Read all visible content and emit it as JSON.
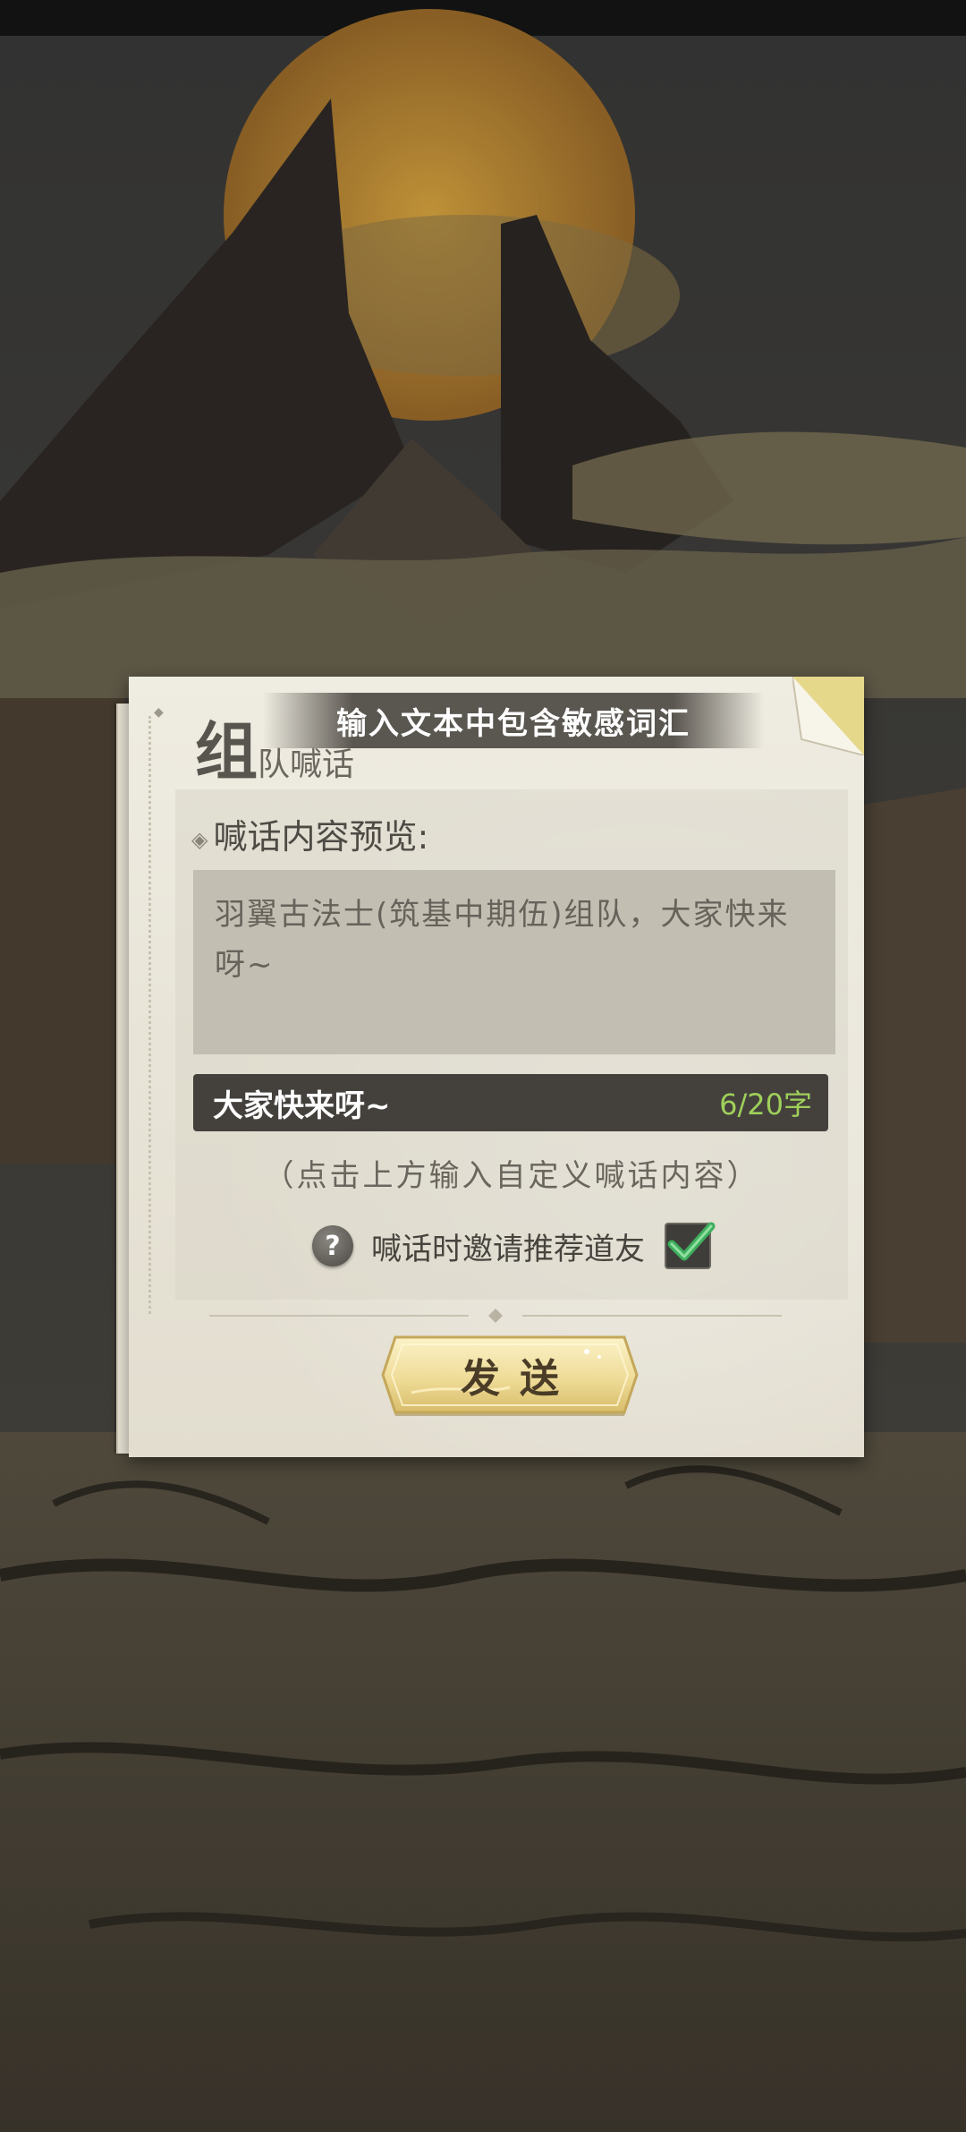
{
  "dialog": {
    "banner": "输入文本中包含敏感词汇",
    "title_big": "组",
    "title_small": "队喊话",
    "preview_label": "喊话内容预览:",
    "preview_text": "羽翼古法士(筑基中期伍)组队，大家快来呀~",
    "input_value": "大家快来呀~",
    "char_count": "6/20字",
    "hint": "（点击上方输入自定义喊话内容）",
    "help_icon": "?",
    "invite_label": "喊话时邀请推荐道友",
    "invite_checked": true,
    "send_label": "发送"
  },
  "colors": {
    "char_count": "#9fd05a",
    "check": "#3fae5e",
    "input_bg": "#44413d",
    "banner_bg": "#46423c"
  },
  "icons": [
    "help-icon",
    "check-icon",
    "page-fold-icon",
    "diamond-icon"
  ]
}
